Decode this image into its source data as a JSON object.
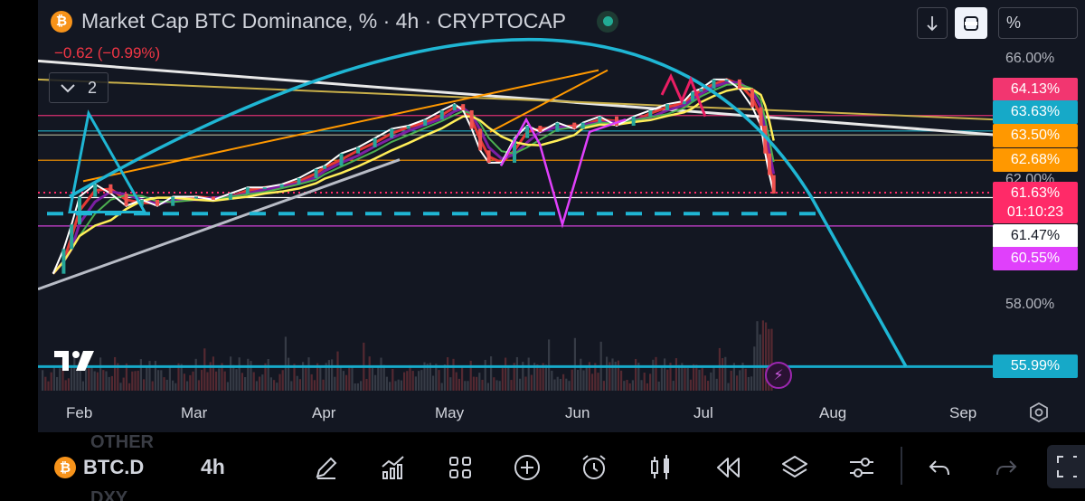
{
  "header": {
    "coin_glyph": "₿",
    "title": "Market Cap BTC Dominance, % · 4h · CRYPTOCAP",
    "change": "−0.62 (−0.99%)",
    "indicators_count": "2"
  },
  "top_tools": {
    "scale_mode": "%",
    "down_icon": "arrow-down-icon",
    "auto_icon": "auto-scale-icon"
  },
  "chart_data": {
    "type": "candlestick",
    "symbol": "BTC.D",
    "interval": "4h",
    "source": "CRYPTOCAP",
    "unit": "%",
    "x_ticks": [
      "Feb",
      "Mar",
      "Apr",
      "May",
      "Jun",
      "Jul",
      "Aug",
      "Sep"
    ],
    "y_ticks": [
      "66.00%",
      "62.00%",
      "58.00%",
      "55.99%"
    ],
    "y_range": [
      55.3,
      66.6
    ],
    "price_path": [
      [
        "Jan 21",
        59.0
      ],
      [
        "Jan 25",
        59.8
      ],
      [
        "Jan 28",
        60.6
      ],
      [
        "Feb 1",
        61.5
      ],
      [
        "Feb 5",
        61.9
      ],
      [
        "Feb 9",
        61.6
      ],
      [
        "Feb 13",
        61.2
      ],
      [
        "Feb 17",
        61.4
      ],
      [
        "Feb 21",
        61.2
      ],
      [
        "Feb 25",
        61.5
      ],
      [
        "Mar 1",
        61.5
      ],
      [
        "Mar 5",
        61.4
      ],
      [
        "Mar 9",
        61.6
      ],
      [
        "Mar 13",
        61.8
      ],
      [
        "Mar 17",
        61.8
      ],
      [
        "Mar 21",
        61.9
      ],
      [
        "Mar 25",
        62.1
      ],
      [
        "Mar 29",
        62.4
      ],
      [
        "Apr 1",
        62.5
      ],
      [
        "Apr 5",
        62.9
      ],
      [
        "Apr 9",
        63.1
      ],
      [
        "Apr 13",
        63.4
      ],
      [
        "Apr 17",
        63.7
      ],
      [
        "Apr 21",
        63.8
      ],
      [
        "Apr 25",
        64.0
      ],
      [
        "Apr 29",
        64.3
      ],
      [
        "May 2",
        64.5
      ],
      [
        "May 4",
        64.3
      ],
      [
        "May 6",
        63.7
      ],
      [
        "May 8",
        63.0
      ],
      [
        "May 10",
        62.6
      ],
      [
        "May 13",
        62.6
      ],
      [
        "May 16",
        63.4
      ],
      [
        "May 19",
        63.8
      ],
      [
        "May 22",
        63.6
      ],
      [
        "May 26",
        63.9
      ],
      [
        "May 30",
        63.7
      ],
      [
        "Jun 2",
        63.9
      ],
      [
        "Jun 6",
        64.1
      ],
      [
        "Jun 10",
        63.8
      ],
      [
        "Jun 14",
        64.1
      ],
      [
        "Jun 18",
        64.3
      ],
      [
        "Jun 22",
        64.5
      ],
      [
        "Jun 26",
        64.6
      ],
      [
        "Jun 28",
        64.9
      ],
      [
        "Jun 30",
        65.0
      ],
      [
        "Jul 3",
        65.3
      ],
      [
        "Jul 6",
        65.3
      ],
      [
        "Jul 9",
        65.0
      ],
      [
        "Jul 12",
        64.4
      ],
      [
        "Jul 14",
        63.8
      ],
      [
        "Jul 15",
        62.9
      ],
      [
        "Jul 16",
        62.2
      ],
      [
        "Jul 17",
        61.6
      ]
    ],
    "levels": [
      {
        "price": 64.13,
        "label": "64.13%",
        "color": "#f23670",
        "line": "#d92f70"
      },
      {
        "price": 63.63,
        "label": "63.63%",
        "color": "#16a9c8",
        "line": "#20b0c8"
      },
      {
        "price": 63.5,
        "label": "63.50%",
        "color": "#ff9800",
        "line": "#a0a48c"
      },
      {
        "price": 62.68,
        "label": "62.68%",
        "color": "#ff9800",
        "line": "#ff9800"
      },
      {
        "price": 61.63,
        "label": "61.63%",
        "color": "#ff2a68",
        "line": "#ff2a68",
        "countdown": "01:10:23"
      },
      {
        "price": 61.47,
        "label": "61.47%",
        "color": "#ffffff",
        "line": "#ffffff"
      },
      {
        "price": 60.55,
        "label": "60.55%",
        "color": "#e040fb",
        "line": "#d041d8"
      },
      {
        "price": 55.99,
        "label": "55.99%",
        "color": "#16a9c8",
        "line": "#16a9c8"
      }
    ],
    "grid": false,
    "legend": "none"
  },
  "toolbar": {
    "symbol": "BTC.D",
    "timeframe": "4h",
    "ghost_above": "OTHER",
    "ghost_below": "DXY",
    "tools": [
      "pencil-icon",
      "indicators-icon",
      "grid-icon",
      "plus-icon",
      "alarm-icon",
      "candles-icon",
      "replay-icon",
      "layers-icon",
      "settings-icon",
      "undo-icon",
      "redo-icon"
    ]
  }
}
